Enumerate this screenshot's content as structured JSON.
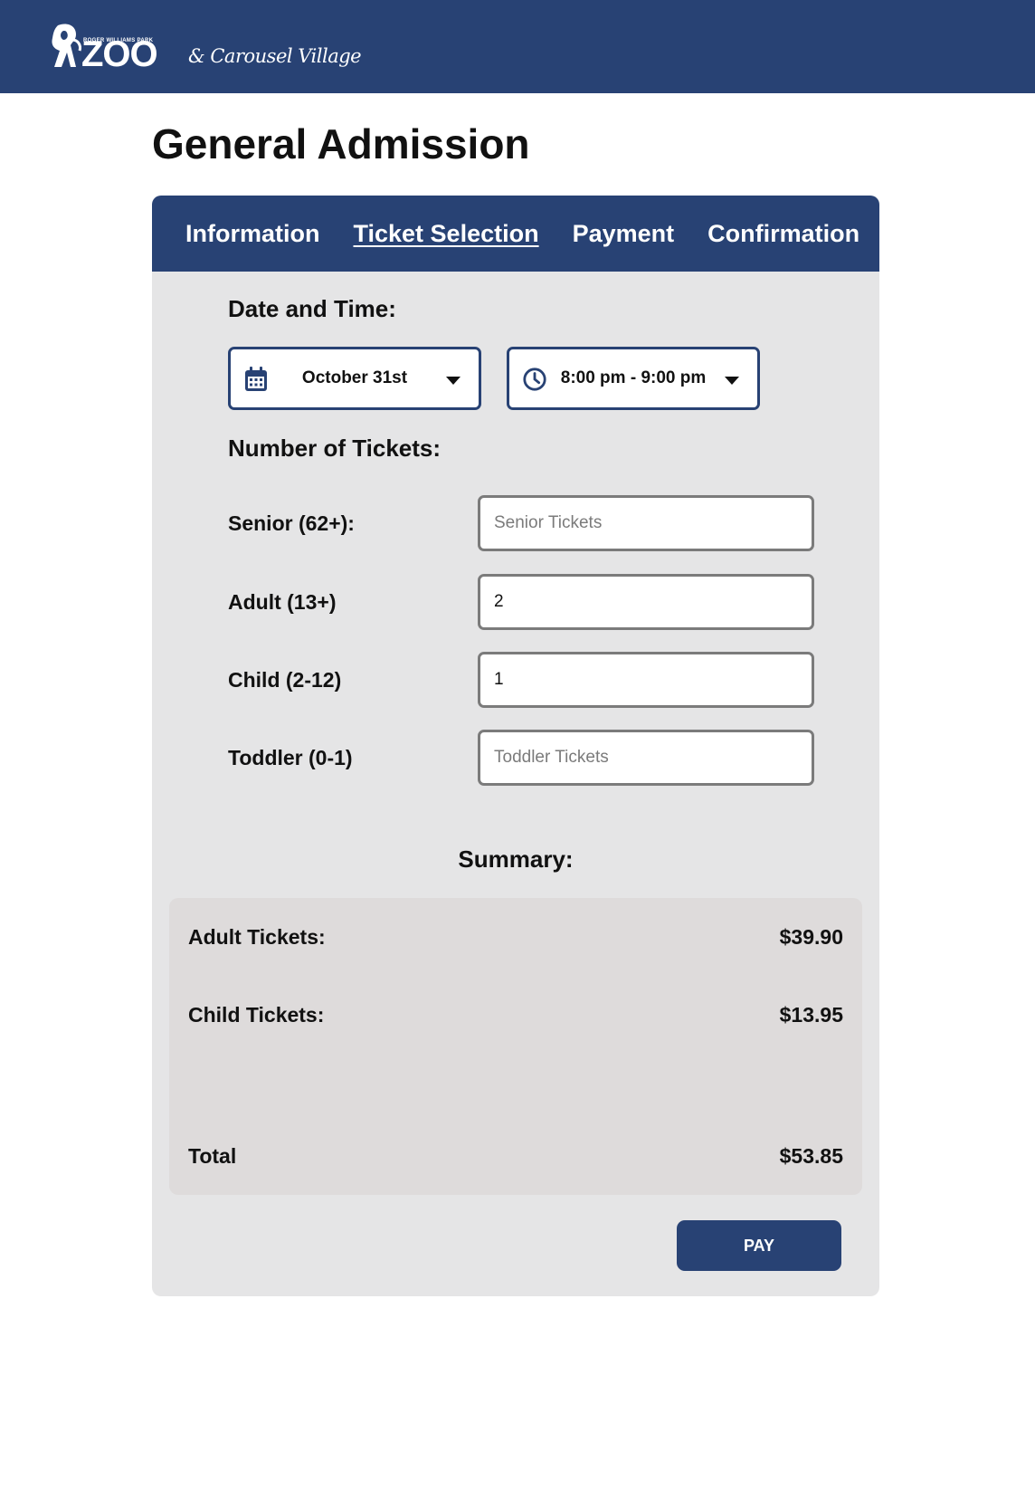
{
  "header": {
    "logo_small": "ROGER WILLIAMS PARK",
    "logo_main": "ZOO",
    "logo_sub": "& Carousel Village"
  },
  "page": {
    "title": "General Admission"
  },
  "tabs": [
    {
      "label": "Information",
      "active": false
    },
    {
      "label": "Ticket Selection",
      "active": true
    },
    {
      "label": "Payment",
      "active": false
    },
    {
      "label": "Confirmation",
      "active": false
    }
  ],
  "date_time": {
    "heading": "Date and Time:",
    "date_value": "October 31st",
    "date_icon": "calendar-icon",
    "time_value": "8:00 pm - 9:00 pm",
    "time_icon": "clock-icon"
  },
  "tickets": {
    "heading": "Number of Tickets:",
    "rows": [
      {
        "label": "Senior (62+):",
        "value": "",
        "placeholder": "Senior Tickets"
      },
      {
        "label": "Adult (13+)",
        "value": "2",
        "placeholder": ""
      },
      {
        "label": "Child (2-12)",
        "value": "1",
        "placeholder": ""
      },
      {
        "label": "Toddler (0-1)",
        "value": "",
        "placeholder": "Toddler Tickets"
      }
    ]
  },
  "summary": {
    "heading": "Summary:",
    "lines": [
      {
        "label": "Adult Tickets:",
        "amount": "$39.90"
      },
      {
        "label": "Child Tickets:",
        "amount": "$13.95"
      }
    ],
    "total_label": "Total",
    "total_amount": "$53.85"
  },
  "actions": {
    "pay_label": "PAY"
  },
  "colors": {
    "brand_navy": "#284274",
    "card_bg": "#e5e5e6",
    "summary_bg": "#dedbdb",
    "input_border": "#7b7b7b"
  }
}
